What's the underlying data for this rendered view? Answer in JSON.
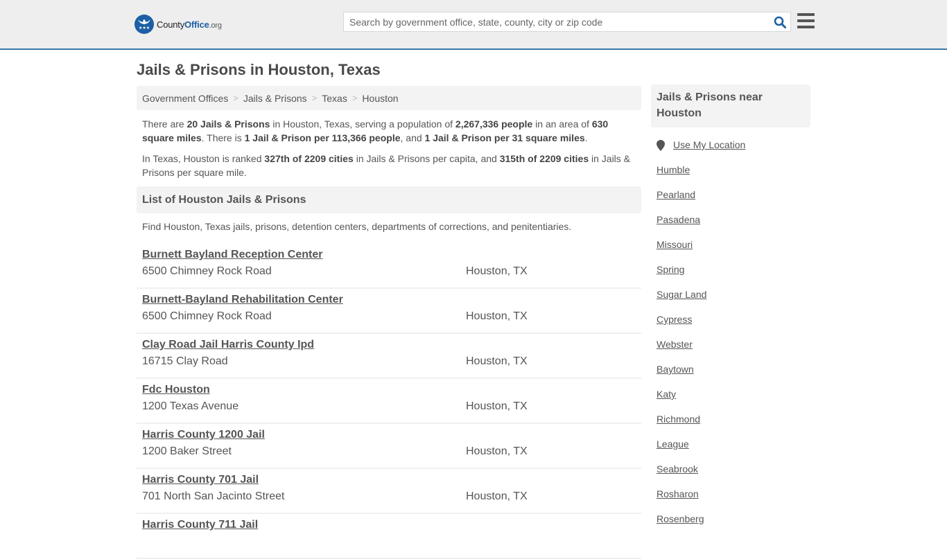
{
  "header": {
    "logo": {
      "name_part1": "County",
      "name_part2": "Office",
      "name_part3": ".org"
    },
    "search": {
      "placeholder": "Search by government office, state, county, city or zip code",
      "value": ""
    },
    "colors": {
      "accent": "#3a78a8",
      "brand": "#1d5fa4"
    }
  },
  "page": {
    "title": "Jails & Prisons in Houston, Texas"
  },
  "breadcrumb": [
    {
      "label": "Government Offices"
    },
    {
      "label": "Jails & Prisons"
    },
    {
      "label": "Texas"
    },
    {
      "label": "Houston"
    }
  ],
  "intro": {
    "p1": {
      "t1": "There are ",
      "b1": "20 Jails & Prisons",
      "t2": " in Houston, Texas, serving a population of ",
      "b2": "2,267,336 people",
      "t3": " in an area of ",
      "b3": "630 square miles",
      "t4": ". There is ",
      "b4": "1 Jail & Prison per 113,366 people",
      "t5": ", and ",
      "b5": "1 Jail & Prison per 31 square miles",
      "t6": "."
    },
    "p2": {
      "t1": "In Texas, Houston is ranked ",
      "b1": "327th of 2209 cities",
      "t2": " in Jails & Prisons per capita, and ",
      "b2": "315th of 2209 cities",
      "t3": " in Jails & Prisons per square mile."
    }
  },
  "list_section": {
    "title": "List of Houston Jails & Prisons",
    "description": "Find Houston, Texas jails, prisons, detention centers, departments of corrections, and penitentiaries.",
    "items": [
      {
        "name": "Burnett Bayland Reception Center",
        "address": "6500 Chimney Rock Road",
        "city": "Houston, TX"
      },
      {
        "name": "Burnett-Bayland Rehabilitation Center",
        "address": "6500 Chimney Rock Road",
        "city": "Houston, TX"
      },
      {
        "name": "Clay Road Jail Harris County Ipd",
        "address": "16715 Clay Road",
        "city": "Houston, TX"
      },
      {
        "name": "Fdc Houston",
        "address": "1200 Texas Avenue",
        "city": "Houston, TX"
      },
      {
        "name": "Harris County 1200 Jail",
        "address": "1200 Baker Street",
        "city": "Houston, TX"
      },
      {
        "name": "Harris County 701 Jail",
        "address": "701 North San Jacinto Street",
        "city": "Houston, TX"
      },
      {
        "name": "Harris County 711 Jail",
        "address": "",
        "city": ""
      }
    ]
  },
  "sidebar": {
    "title": "Jails & Prisons near Houston",
    "use_location": "Use My Location",
    "cities": [
      "Humble",
      "Pearland",
      "Pasadena",
      "Missouri",
      "Spring",
      "Sugar Land",
      "Cypress",
      "Webster",
      "Baytown",
      "Katy",
      "Richmond",
      "League",
      "Seabrook",
      "Rosharon",
      "Rosenberg"
    ]
  }
}
